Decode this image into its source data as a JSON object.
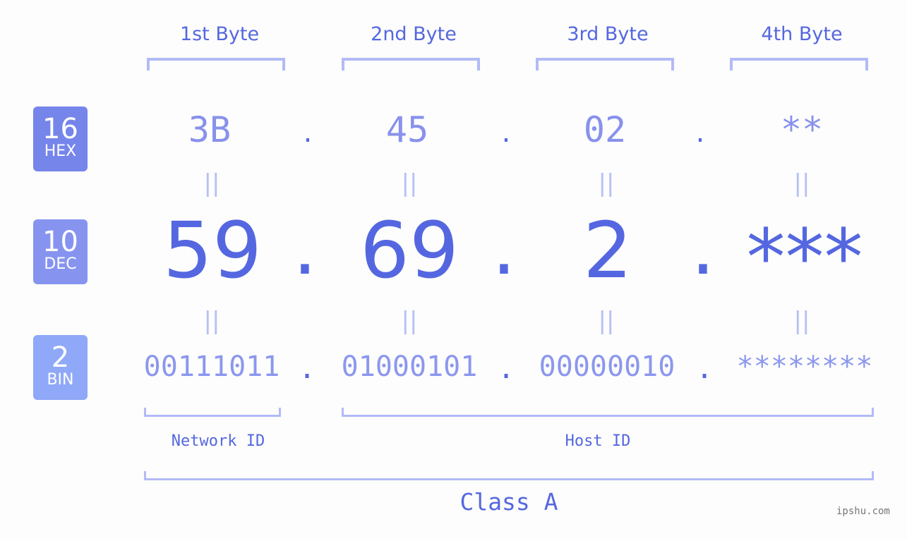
{
  "headers": [
    "1st Byte",
    "2nd Byte",
    "3rd Byte",
    "4th Byte"
  ],
  "badges": [
    {
      "num": "16",
      "label": "HEX",
      "color": "#7585ea"
    },
    {
      "num": "10",
      "label": "DEC",
      "color": "#8694f0"
    },
    {
      "num": "2",
      "label": "BIN",
      "color": "#8fa8f7"
    }
  ],
  "hex": [
    "3B",
    "45",
    "02",
    "**"
  ],
  "dec": [
    "59",
    "69",
    "2",
    "***"
  ],
  "bin": [
    "00111011",
    "01000101",
    "00000010",
    "********"
  ],
  "separator": ".",
  "equals": "||",
  "network_label": "Network ID",
  "host_label": "Host ID",
  "class_label": "Class A",
  "watermark": "ipshu.com"
}
